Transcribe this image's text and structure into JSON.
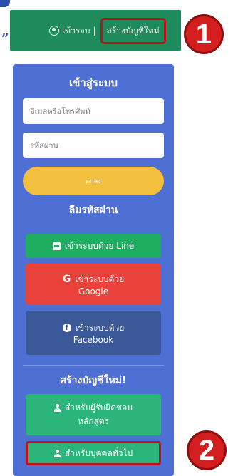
{
  "decor": {
    "quote_mark": "”"
  },
  "header": {
    "login_link": "เข้าระบ",
    "separator": "|",
    "register_link": "สร้างบัญชีใหม่"
  },
  "annotations": {
    "badge_1": "1",
    "badge_2": "2"
  },
  "login_panel": {
    "title": "เข้าสู่ระบบ",
    "email_placeholder": "อีเมลหรือโทรศัพท์",
    "password_placeholder": "รหัสผ่าน",
    "login_button": "ตกลง",
    "forgot_password": "ลืมรหัสผ่าน",
    "line_button": "เข้าระบบด้วย Line",
    "google_button_line1": "เข้าระบบด้วย",
    "google_button_line2": "Google",
    "facebook_button_line1": "เข้าระบบด้วย",
    "facebook_button_line2": "Facebook"
  },
  "register_panel": {
    "title": "สร้างบัญชีใหม่!",
    "instructor_line1": "สำหรับผู้รับผิดชอบ",
    "instructor_line2": "หลักสูตร",
    "general_button": "สำหรับบุคคลทั่วไป"
  },
  "colors": {
    "topbar": "#1f8a5b",
    "panel": "#4e6fd3",
    "login_button": "#f2bf3f",
    "line": "#1fad62",
    "google": "#e8423b",
    "facebook": "#3b5998",
    "highlight": "#c0121c"
  }
}
